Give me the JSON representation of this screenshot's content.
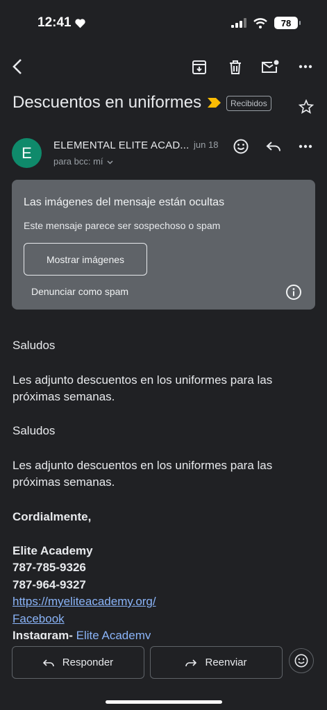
{
  "status_bar": {
    "time": "12:41",
    "battery": "78"
  },
  "email": {
    "subject": "Descuentos en uniformes",
    "label": "Recibidos",
    "sender_initial": "E",
    "sender": "ELEMENTAL ELITE ACAD...",
    "date": "jun 18",
    "recipient": "para bcc: mí"
  },
  "warning": {
    "title": "Las imágenes del mensaje están ocultas",
    "subtitle": "Este mensaje parece ser sospechoso o spam",
    "show_images_label": "Mostrar imágenes",
    "report_spam_label": "Denunciar como spam"
  },
  "body": {
    "greeting1": "Saludos",
    "paragraph1": "Les adjunto descuentos en los uniformes para las próximas semanas.",
    "greeting2": "Saludos",
    "paragraph2": "Les adjunto descuentos en los uniformes para las próximas semanas.",
    "closing": "Cordialmente,",
    "signature_name": "Elite Academy",
    "phone1": "787-785-9326",
    "phone2": "787-964-9327",
    "website": "https://myeliteacademy.org/",
    "facebook": "Facebook",
    "instagram_label": "Instagram",
    "instagram_sep": "- ",
    "instagram_link": "Elite Academy"
  },
  "actions": {
    "reply_label": "Responder",
    "forward_label": "Reenviar"
  },
  "colors": {
    "background": "#202124",
    "card": "#5f6368",
    "avatar": "#0f8a6b",
    "link": "#8ab4f8",
    "important_marker": "#fbbc04"
  }
}
